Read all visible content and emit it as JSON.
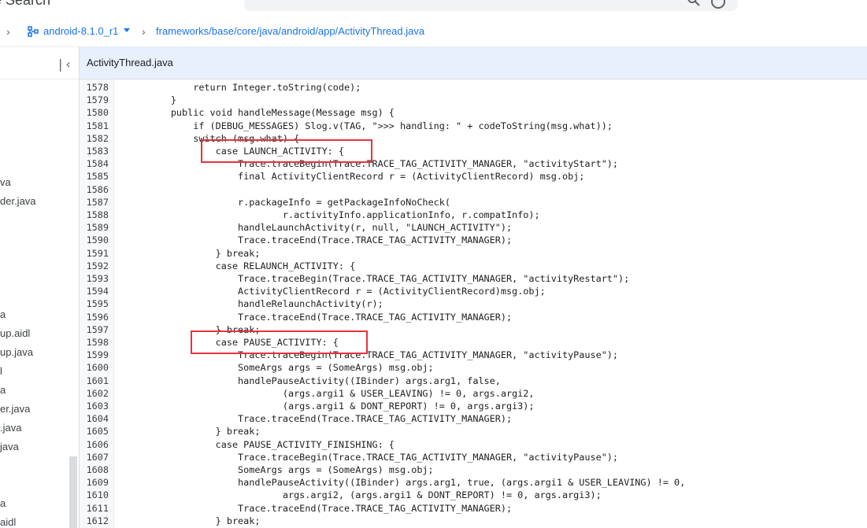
{
  "top": {
    "title": "de Search"
  },
  "breadcrumb": {
    "branch": "android-8.1.0_r1",
    "path": "frameworks/base/core/java/android/app/ActivityThread.java"
  },
  "sidebar": {
    "items": [
      {
        "label": "va"
      },
      {
        "label": "der.java"
      },
      {
        "label": "a"
      },
      {
        "label": "up.aidl"
      },
      {
        "label": "up.java"
      },
      {
        "label": "l"
      },
      {
        "label": "a"
      },
      {
        "label": "er.java"
      },
      {
        "label": ".java"
      },
      {
        "label": "java"
      },
      {
        "label": "a"
      },
      {
        "label": "aidl"
      }
    ]
  },
  "file": {
    "tab": "ActivityThread.java"
  },
  "code": {
    "lines": [
      {
        "n": "1578",
        "t": "            return Integer.toString(code);"
      },
      {
        "n": "1579",
        "t": "        }"
      },
      {
        "n": "1580",
        "t": "        public void handleMessage(Message msg) {"
      },
      {
        "n": "1581",
        "t": "            if (DEBUG_MESSAGES) Slog.v(TAG, \">>> handling: \" + codeToString(msg.what));"
      },
      {
        "n": "1582",
        "t": "            switch (msg.what) {"
      },
      {
        "n": "1583",
        "t": "                case LAUNCH_ACTIVITY: {"
      },
      {
        "n": "1584",
        "t": "                    Trace.traceBegin(Trace.TRACE_TAG_ACTIVITY_MANAGER, \"activityStart\");"
      },
      {
        "n": "1585",
        "t": "                    final ActivityClientRecord r = (ActivityClientRecord) msg.obj;"
      },
      {
        "n": "1586",
        "t": ""
      },
      {
        "n": "1587",
        "t": "                    r.packageInfo = getPackageInfoNoCheck("
      },
      {
        "n": "1588",
        "t": "                            r.activityInfo.applicationInfo, r.compatInfo);"
      },
      {
        "n": "1589",
        "t": "                    handleLaunchActivity(r, null, \"LAUNCH_ACTIVITY\");"
      },
      {
        "n": "1590",
        "t": "                    Trace.traceEnd(Trace.TRACE_TAG_ACTIVITY_MANAGER);"
      },
      {
        "n": "1591",
        "t": "                } break;"
      },
      {
        "n": "1592",
        "t": "                case RELAUNCH_ACTIVITY: {"
      },
      {
        "n": "1593",
        "t": "                    Trace.traceBegin(Trace.TRACE_TAG_ACTIVITY_MANAGER, \"activityRestart\");"
      },
      {
        "n": "1594",
        "t": "                    ActivityClientRecord r = (ActivityClientRecord)msg.obj;"
      },
      {
        "n": "1595",
        "t": "                    handleRelaunchActivity(r);"
      },
      {
        "n": "1596",
        "t": "                    Trace.traceEnd(Trace.TRACE_TAG_ACTIVITY_MANAGER);"
      },
      {
        "n": "1597",
        "t": "                } break;"
      },
      {
        "n": "1598",
        "t": "                case PAUSE_ACTIVITY: {"
      },
      {
        "n": "1599",
        "t": "                    Trace.traceBegin(Trace.TRACE_TAG_ACTIVITY_MANAGER, \"activityPause\");"
      },
      {
        "n": "1600",
        "t": "                    SomeArgs args = (SomeArgs) msg.obj;"
      },
      {
        "n": "1601",
        "t": "                    handlePauseActivity((IBinder) args.arg1, false,"
      },
      {
        "n": "1602",
        "t": "                            (args.argi1 & USER_LEAVING) != 0, args.argi2,"
      },
      {
        "n": "1603",
        "t": "                            (args.argi1 & DONT_REPORT) != 0, args.argi3);"
      },
      {
        "n": "1604",
        "t": "                    Trace.traceEnd(Trace.TRACE_TAG_ACTIVITY_MANAGER);"
      },
      {
        "n": "1605",
        "t": "                } break;"
      },
      {
        "n": "1606",
        "t": "                case PAUSE_ACTIVITY_FINISHING: {"
      },
      {
        "n": "1607",
        "t": "                    Trace.traceBegin(Trace.TRACE_TAG_ACTIVITY_MANAGER, \"activityPause\");"
      },
      {
        "n": "1608",
        "t": "                    SomeArgs args = (SomeArgs) msg.obj;"
      },
      {
        "n": "1609",
        "t": "                    handlePauseActivity((IBinder) args.arg1, true, (args.argi1 & USER_LEAVING) != 0,"
      },
      {
        "n": "1610",
        "t": "                            args.argi2, (args.argi1 & DONT_REPORT) != 0, args.argi3);"
      },
      {
        "n": "1611",
        "t": "                    Trace.traceEnd(Trace.TRACE_TAG_ACTIVITY_MANAGER);"
      },
      {
        "n": "1612",
        "t": "                } break;"
      }
    ]
  }
}
